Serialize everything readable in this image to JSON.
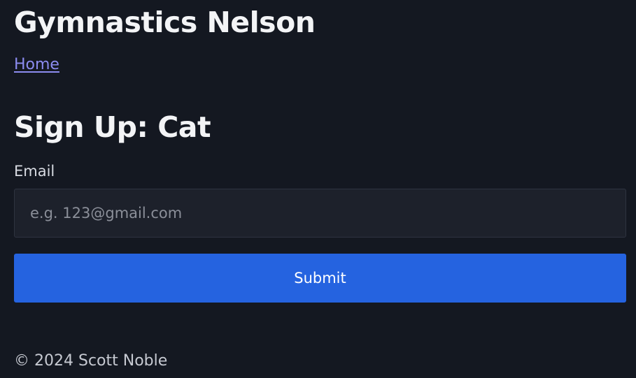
{
  "header": {
    "site_title": "Gymnastics Nelson",
    "nav_home": "Home"
  },
  "main": {
    "heading": "Sign Up: Cat",
    "email_label": "Email",
    "email_placeholder": "e.g. 123@gmail.com",
    "email_value": "",
    "submit_label": "Submit"
  },
  "footer": {
    "copyright": "© 2024 Scott Noble"
  },
  "colors": {
    "background": "#141821",
    "link": "#8c8cf0",
    "button": "#2563e0",
    "input_background": "#1d212b"
  }
}
